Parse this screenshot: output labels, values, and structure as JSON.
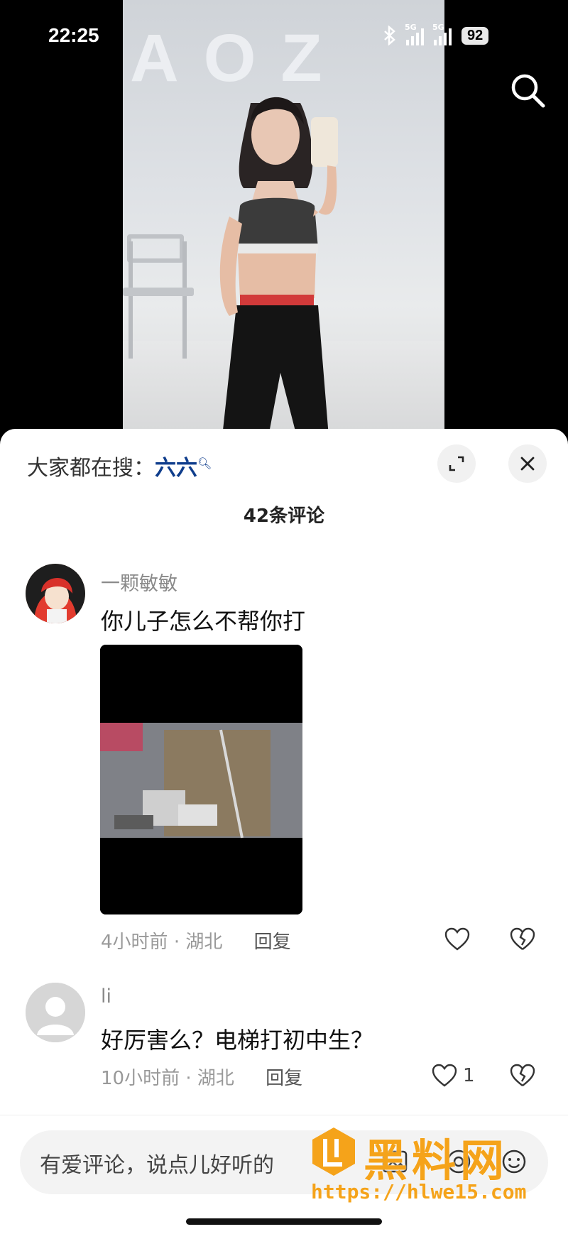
{
  "status_bar": {
    "time": "22:25",
    "signal1_label": "5G",
    "signal2_label": "5G",
    "battery": "92"
  },
  "video": {
    "wall_logo": "AOZ"
  },
  "sheet": {
    "hot_search_prefix": "大家都在搜：",
    "hot_search_term": "六六",
    "comment_count": "42条评论"
  },
  "comments": [
    {
      "username": "一颗敏敏",
      "text": "你儿子怎么不帮你打",
      "time": "4小时前",
      "location": "湖北",
      "reply_label": "回复",
      "like_count": ""
    },
    {
      "username": "li",
      "text": "好厉害么？电梯打初中生？",
      "time": "10小时前",
      "location": "湖北",
      "reply_label": "回复",
      "like_count": "1"
    }
  ],
  "composer": {
    "placeholder": "有爱评论，说点儿好听的"
  },
  "watermark": {
    "brand": "黑料网",
    "url": "https://hlwe15.com"
  },
  "colors": {
    "accent_link": "#0f3d8c",
    "watermark": "#f5a31a"
  }
}
